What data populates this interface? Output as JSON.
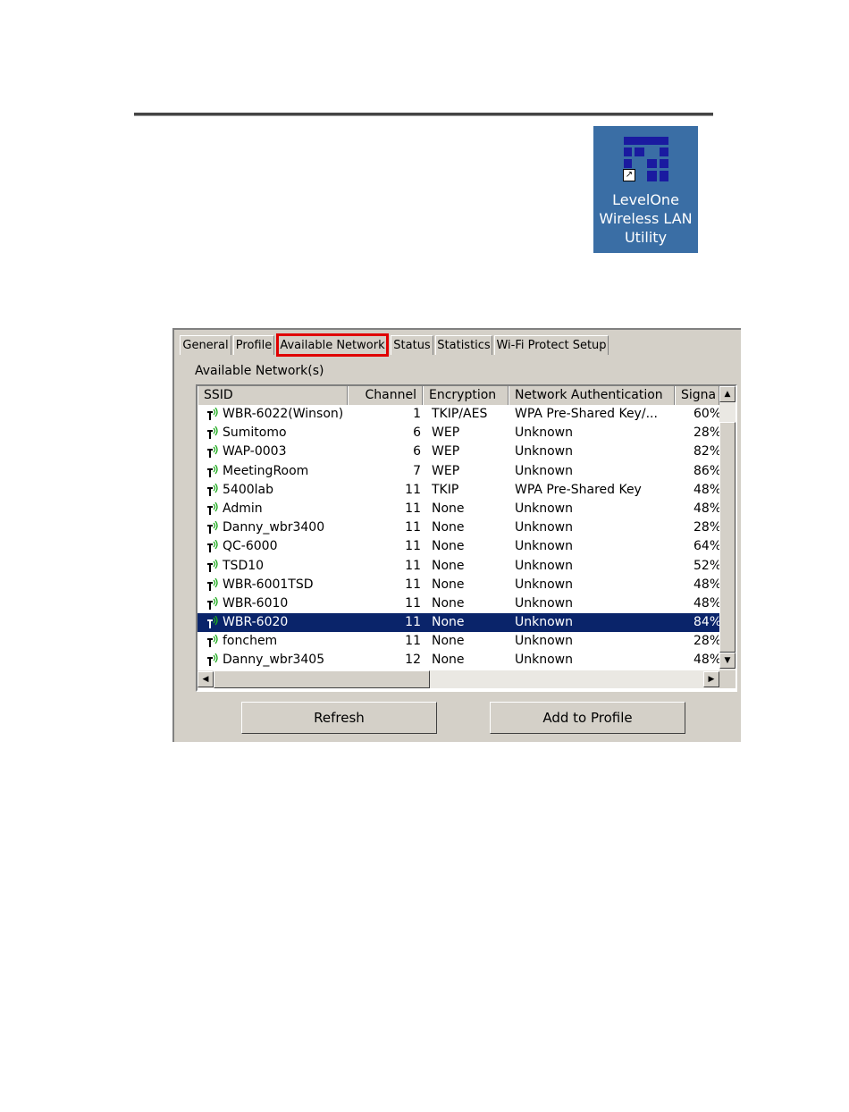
{
  "desktop_icon": {
    "caption_lines": [
      "LevelOne",
      "Wireless LAN",
      "Utility"
    ],
    "shortcut_glyph": "↗",
    "icon": "levelone-logo-icon",
    "background_color": "#3a6ea5"
  },
  "dialog": {
    "tabs": [
      {
        "label": "General",
        "active": false
      },
      {
        "label": "Profile",
        "active": false
      },
      {
        "label": "Available Network",
        "active": true
      },
      {
        "label": "Status",
        "active": false
      },
      {
        "label": "Statistics",
        "active": false
      },
      {
        "label": "Wi-Fi Protect Setup",
        "active": false
      }
    ],
    "group_label": "Available Network(s)",
    "columns": [
      "SSID",
      "Channel",
      "Encryption",
      "Network Authentication",
      "Signa"
    ],
    "networks": [
      {
        "ssid": "WBR-6022(Winson)",
        "channel": "1",
        "encryption": "TKIP/AES",
        "auth": "WPA Pre-Shared Key/...",
        "signal": "60%"
      },
      {
        "ssid": "Sumitomo",
        "channel": "6",
        "encryption": "WEP",
        "auth": "Unknown",
        "signal": "28%"
      },
      {
        "ssid": "WAP-0003",
        "channel": "6",
        "encryption": "WEP",
        "auth": "Unknown",
        "signal": "82%"
      },
      {
        "ssid": "MeetingRoom",
        "channel": "7",
        "encryption": "WEP",
        "auth": "Unknown",
        "signal": "86%"
      },
      {
        "ssid": "5400lab",
        "channel": "11",
        "encryption": "TKIP",
        "auth": "WPA Pre-Shared Key",
        "signal": "48%"
      },
      {
        "ssid": "Admin",
        "channel": "11",
        "encryption": "None",
        "auth": "Unknown",
        "signal": "48%"
      },
      {
        "ssid": "Danny_wbr3400",
        "channel": "11",
        "encryption": "None",
        "auth": "Unknown",
        "signal": "28%"
      },
      {
        "ssid": "QC-6000",
        "channel": "11",
        "encryption": "None",
        "auth": "Unknown",
        "signal": "64%"
      },
      {
        "ssid": "TSD10",
        "channel": "11",
        "encryption": "None",
        "auth": "Unknown",
        "signal": "52%"
      },
      {
        "ssid": "WBR-6001TSD",
        "channel": "11",
        "encryption": "None",
        "auth": "Unknown",
        "signal": "48%"
      },
      {
        "ssid": "WBR-6010",
        "channel": "11",
        "encryption": "None",
        "auth": "Unknown",
        "signal": "48%"
      },
      {
        "ssid": "WBR-6020",
        "channel": "11",
        "encryption": "None",
        "auth": "Unknown",
        "signal": "84%",
        "selected": true
      },
      {
        "ssid": "fonchem",
        "channel": "11",
        "encryption": "None",
        "auth": "Unknown",
        "signal": "28%"
      },
      {
        "ssid": "Danny_wbr3405",
        "channel": "12",
        "encryption": "None",
        "auth": "Unknown",
        "signal": "48%"
      }
    ],
    "scroll_glyphs": {
      "up": "▲",
      "down": "▼",
      "left": "◀",
      "right": "▶"
    },
    "buttons": {
      "refresh": "Refresh",
      "add_to_profile": "Add to Profile"
    },
    "selection_color": "#0a246a",
    "highlight_color": "#e00000"
  }
}
